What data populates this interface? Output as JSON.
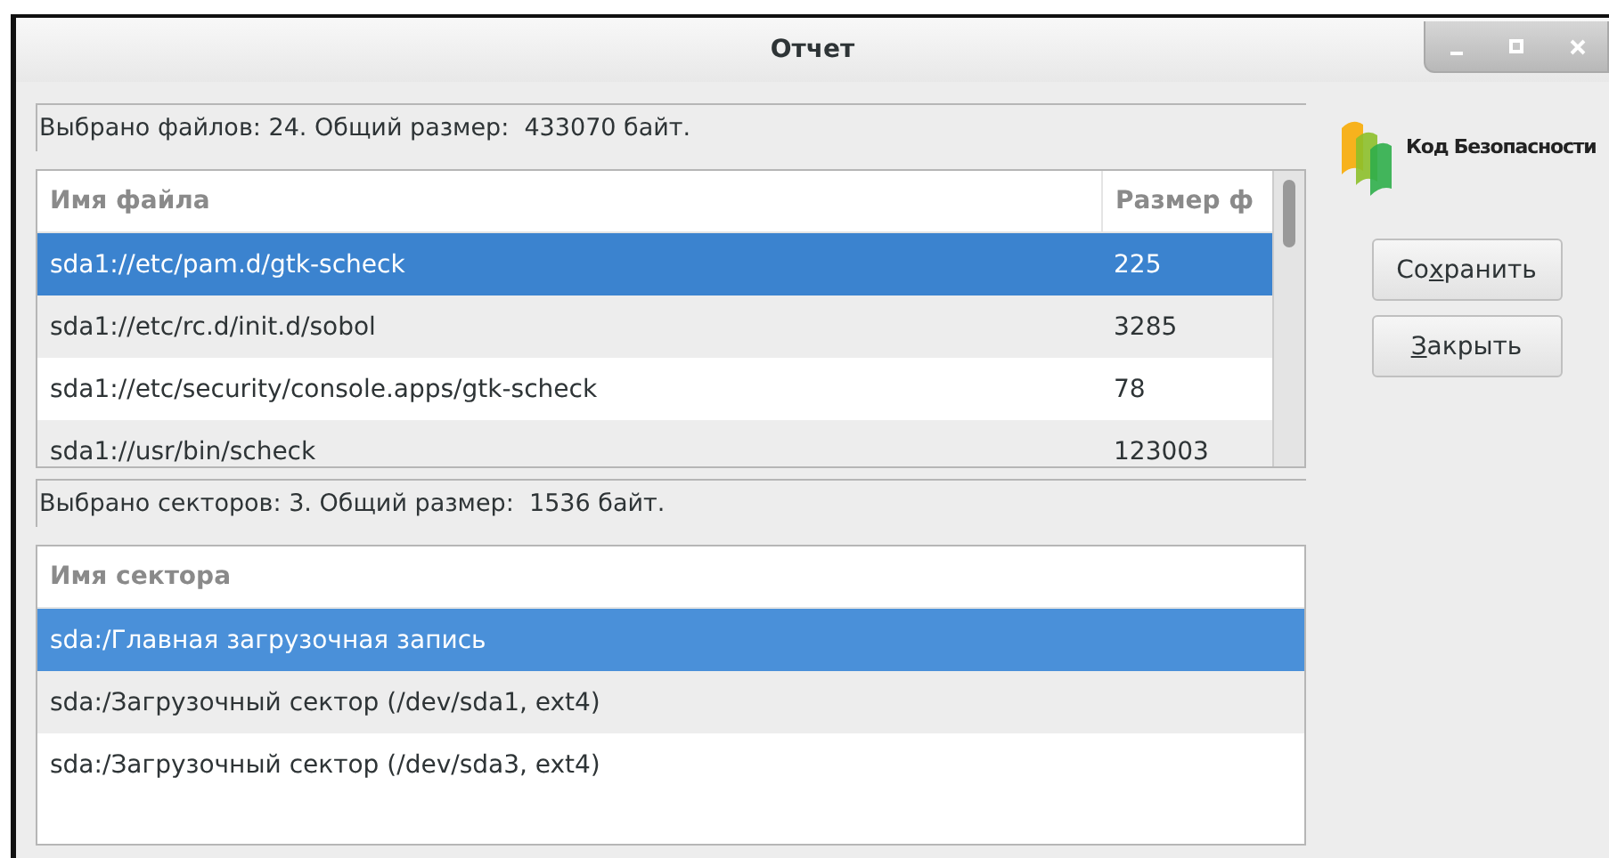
{
  "window": {
    "title": "Отчет"
  },
  "files": {
    "summary": "Выбрано файлов: 24. Общий размер:  433070 байт.",
    "columns": [
      "Имя файла",
      "Размер ф"
    ],
    "rows": [
      {
        "cells": [
          "sda1://etc/pam.d/gtk-scheck",
          "225"
        ],
        "selected": true
      },
      {
        "cells": [
          "sda1://etc/rc.d/init.d/sobol",
          "3285"
        ],
        "selected": false
      },
      {
        "cells": [
          "sda1://etc/security/console.apps/gtk-scheck",
          "78"
        ],
        "selected": false
      },
      {
        "cells": [
          "sda1://usr/bin/scheck",
          "123003"
        ],
        "selected": false
      }
    ]
  },
  "sectors": {
    "summary": "Выбрано секторов: 3. Общий размер:  1536 байт.",
    "columns": [
      "Имя сектора"
    ],
    "rows": [
      {
        "cells": [
          "sda:/Главная загрузочная запись"
        ],
        "selected": true
      },
      {
        "cells": [
          "sda:/Загрузочный сектор (/dev/sda1, ext4)"
        ],
        "selected": false
      },
      {
        "cells": [
          "sda:/Загрузочный сектор (/dev/sda3, ext4)"
        ],
        "selected": false
      }
    ]
  },
  "logo": {
    "text": "Код Безопасности"
  },
  "buttons": [
    {
      "label_before": "Со",
      "access_key": "х",
      "label_after": "ранить"
    },
    {
      "access_key": "З",
      "label_after": "акрыть"
    }
  ]
}
